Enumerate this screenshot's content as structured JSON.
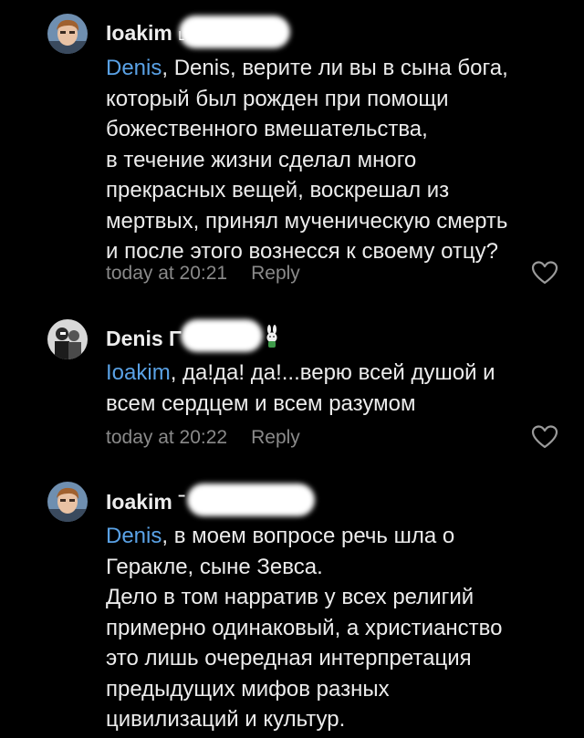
{
  "theme": {
    "background": "#000000",
    "text": "#ececec",
    "mention": "#5aa2e6",
    "muted": "#8a8a8a"
  },
  "comments": [
    {
      "author": "Ioakim ˪",
      "mention": "Denis",
      "text_lines": [
        ", Denis, верите ли вы в сына бога,",
        "который был рожден при помощи",
        "божественного вмешательства,",
        "в течение жизни сделал много",
        "прекрасных вещей, воскрешал из",
        "мертвых, принял мученическую смерть",
        "и после этого вознесся к своему отцу?"
      ],
      "time": "today at 20:21",
      "reply": "Reply",
      "avatar_icon": "user-avatar-icon",
      "like_icon": "heart-outline-icon"
    },
    {
      "author": "Denis Γ",
      "mention": "Ioakim",
      "text_lines": [
        ", да!да! да!...верю всей душой и",
        "всем сердцем и всем разумом"
      ],
      "time": "today at 20:22",
      "reply": "Reply",
      "avatar_icon": "user-avatar-icon",
      "like_icon": "heart-outline-icon"
    },
    {
      "author": "Ioakim ˉ",
      "mention": "Denis",
      "text_lines": [
        ", в моем вопросе речь шла о",
        "Геракле, сыне Зевса.",
        "Дело в том нарратив у всех религий",
        "примерно одинаковый, а христианство",
        "это лишь очередная интерпретация",
        "предыдущих мифов разных",
        "цивилизаций и культур."
      ],
      "avatar_icon": "user-avatar-icon"
    }
  ]
}
